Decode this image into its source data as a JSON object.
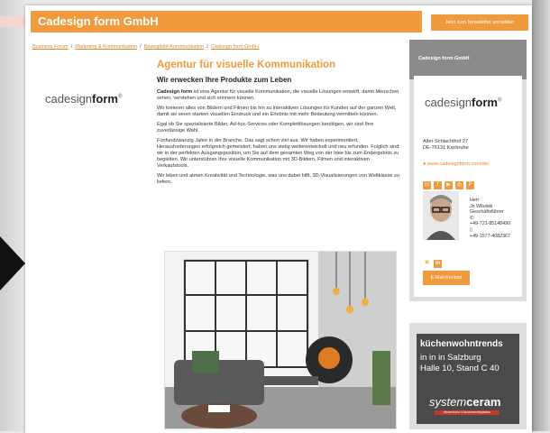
{
  "header": {
    "company": "Cadesign form GmbH",
    "newsletter_button": "Jetzt zum Newsletter anmelden"
  },
  "breadcrumb": {
    "items": [
      "Business Forum",
      "Marketing & Kommunikation",
      "Bewegtbild-Kommunikation",
      "Cadesign form GmbH"
    ],
    "separator": "/"
  },
  "logo": {
    "part1": "cadesign",
    "part2": "form",
    "mark": "®"
  },
  "main": {
    "heading": "Agentur für visuelle Kommunikation",
    "subheading": "Wir erwecken Ihre Produkte zum Leben",
    "p1_bold": "Cadesign form",
    "p1_rest": " ist eine Agentur für visuelle Kommunikation, die visuelle Lösungen entwirft, damit Menschen sehen, verstehen und sich erinnern können.",
    "p2": "Wir kreieren alles von Bildern und Filmen bis hin zu interaktiven Lösungen für Kunden auf der ganzen Welt, damit sie einen starken visuellen Eindruck und ein Erlebnis mit mehr Bedeutung vermitteln können.",
    "p3": "Egal ob Sie spezialisierte Bilder, Ad-hoc-Services oder Komplettlösungen benötigen, wir sind Ihre zuverlässige Wahl.",
    "p4": "Fünfundzwanzig Jahre in der Branche. Das sagt schon viel aus. Wir haben experimentiert, Herausforderungen erfolgreich gemeistert, haben uns stetig weiterentwickelt und neu erfunden. Folglich sind wir in der perfekten Ausgangsposition, um Sie auf dem gesamten Weg von der Idee bis zum Endergebnis zu begleiten. Wir unterstützen Ihre visuelle Kommunikation mit 3D-Bildern, Filmen und interaktiven Verkaufstools.",
    "p5": "Wir leben und atmen Kreativität und Technologie, was uns dabei hilft, 3D-Visualisierungen von Weltklasse zu liefern."
  },
  "sidebar": {
    "title": "Cadesign form GmbH",
    "street": "Alter Schlachthof 27",
    "city": "DE-76131 Karlsruhe",
    "website": "www.cadesignform.com/de/",
    "salutation": "Herr",
    "name": "Jo Witulski",
    "role": "Geschäftsführer",
    "phone": "+49-721-85148490",
    "mobile": "+49-1577-4082367",
    "contact_button": "E-Mail-Kontakt"
  },
  "ad": {
    "line1": "küchenwohntrends",
    "line2": "in in in Salzburg",
    "line3": "Halle 10, Stand C 40",
    "brand_part1": "system",
    "brand_part2": "ceram",
    "brand_tagline": "Keramische Küchenarbeitsplatten"
  },
  "colors": {
    "accent": "#ef9a3c",
    "sidebar_header": "#8b8b8b",
    "ad_bg": "#4a4a4a"
  }
}
